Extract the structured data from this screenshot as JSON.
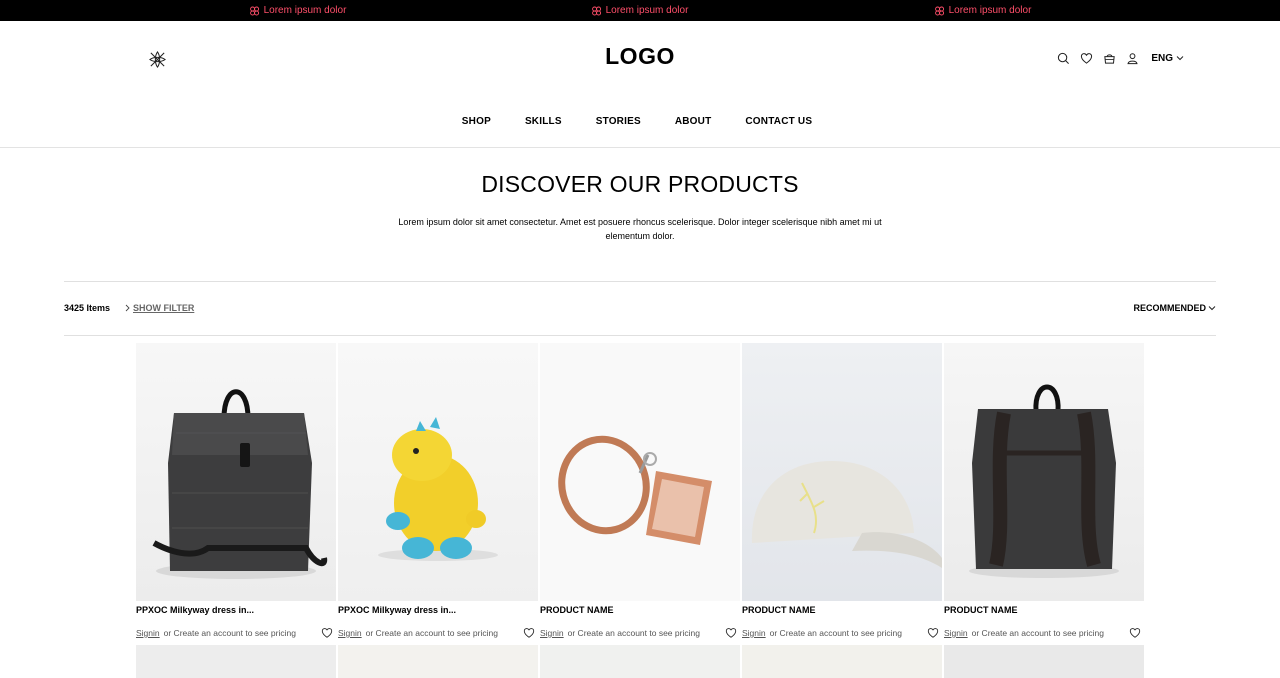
{
  "announcement": {
    "items": [
      "Lorem ipsum dolor",
      "Lorem ipsum dolor",
      "Lorem ipsum dolor"
    ],
    "icon": "flower-icon",
    "color": "#ff4f6a",
    "background": "#000000"
  },
  "header": {
    "brand_icon": "brand-mark-icon",
    "logo": "LOGO",
    "actions": [
      "search-icon",
      "heart-icon",
      "bag-icon",
      "user-icon"
    ],
    "language": "ENG"
  },
  "nav": {
    "items": [
      "SHOP",
      "SKILLS",
      "STORIES",
      "ABOUT",
      "CONTACT US"
    ]
  },
  "hero": {
    "title": "DISCOVER OUR PRODUCTS",
    "description": "Lorem ipsum dolor sit amet consectetur. Amet est posuere rhoncus scelerisque. Dolor integer scelerisque nibh amet mi ut elementum dolor."
  },
  "toolbar": {
    "count": "3425 Items",
    "filter_label": "SHOW FILTER",
    "sort_label": "RECOMMENDED"
  },
  "products": [
    {
      "name": "PPXOC Milkyway dress in...",
      "signin": "Signin",
      "pricing": " or Create an account to see pricing",
      "image": "backpack-front"
    },
    {
      "name": "PPXOC Milkyway dress in...",
      "signin": "Signin",
      "pricing": " or Create an account to see pricing",
      "image": "crochet-dinosaur"
    },
    {
      "name": "PRODUCT NAME",
      "signin": "Signin",
      "pricing": " or Create an account to see pricing",
      "image": "leather-lanyard"
    },
    {
      "name": "PRODUCT NAME",
      "signin": "Signin",
      "pricing": " or Create an account to see pricing",
      "image": "white-cap"
    },
    {
      "name": "PRODUCT NAME",
      "signin": "Signin",
      "pricing": " or Create an account to see pricing",
      "image": "backpack-back"
    }
  ]
}
